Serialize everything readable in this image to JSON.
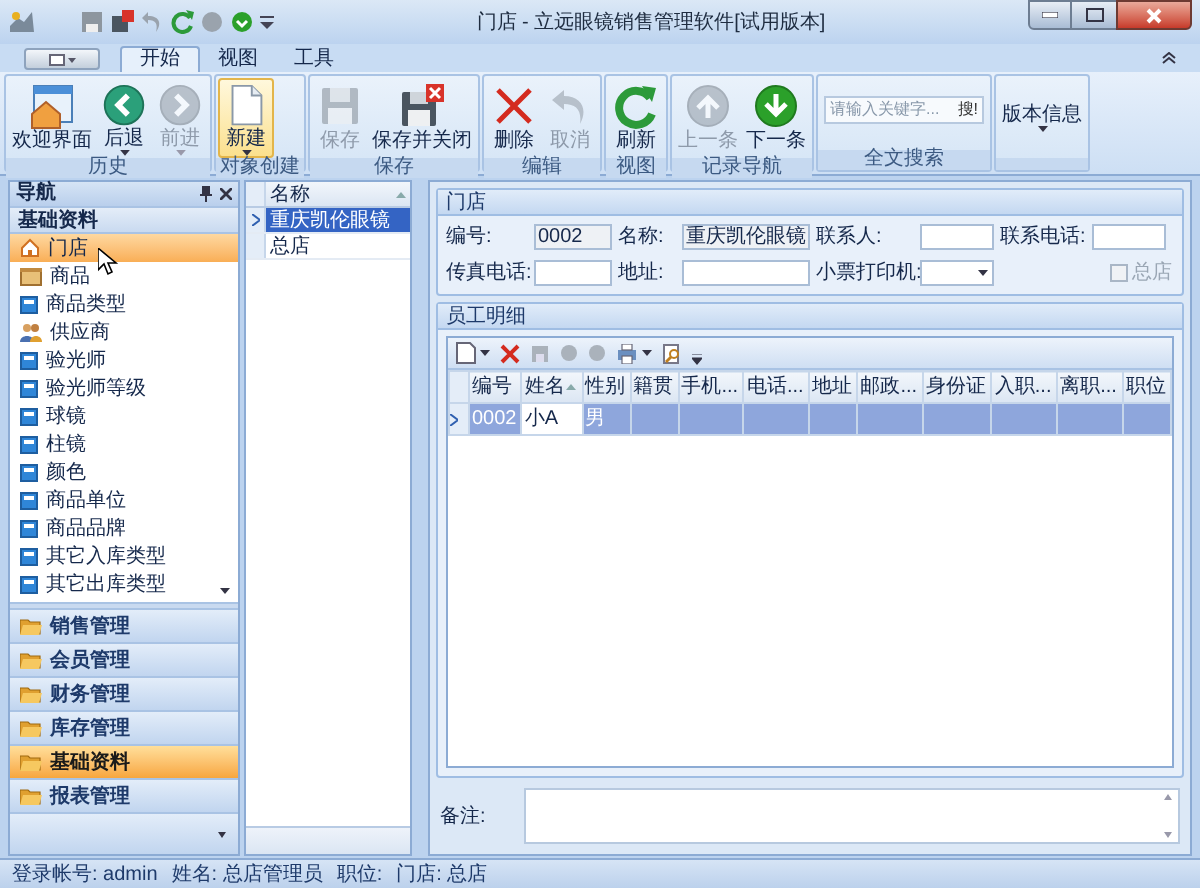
{
  "window": {
    "title": "门店 - 立远眼镜销售管理软件[试用版本]"
  },
  "tabs": [
    {
      "label": "开始",
      "selected": true
    },
    {
      "label": "视图",
      "selected": false
    },
    {
      "label": "工具",
      "selected": false
    }
  ],
  "ribbon": {
    "groups": [
      {
        "label": "历史",
        "buttons": [
          {
            "label": "欢迎界面",
            "kind": "home",
            "disabled": false,
            "highlighted": false,
            "dropdown": false
          },
          {
            "label": "后退",
            "kind": "back",
            "disabled": false,
            "highlighted": false,
            "dropdown": true
          },
          {
            "label": "前进",
            "kind": "forward",
            "disabled": true,
            "highlighted": false,
            "dropdown": true
          }
        ]
      },
      {
        "label": "对象创建",
        "buttons": [
          {
            "label": "新建",
            "kind": "new",
            "disabled": false,
            "highlighted": true,
            "dropdown": true
          }
        ]
      },
      {
        "label": "保存",
        "buttons": [
          {
            "label": "保存",
            "kind": "save",
            "disabled": true,
            "highlighted": false,
            "dropdown": false
          },
          {
            "label": "保存并关闭",
            "kind": "saveclose",
            "disabled": false,
            "highlighted": false,
            "dropdown": false
          }
        ]
      },
      {
        "label": "编辑",
        "buttons": [
          {
            "label": "删除",
            "kind": "delete",
            "disabled": false,
            "highlighted": false,
            "dropdown": false
          },
          {
            "label": "取消",
            "kind": "undo",
            "disabled": true,
            "highlighted": false,
            "dropdown": false
          }
        ]
      },
      {
        "label": "视图",
        "buttons": [
          {
            "label": "刷新",
            "kind": "refresh",
            "disabled": false,
            "highlighted": false,
            "dropdown": false
          }
        ]
      },
      {
        "label": "记录导航",
        "buttons": [
          {
            "label": "上一条",
            "kind": "up",
            "disabled": true,
            "highlighted": false,
            "dropdown": false
          },
          {
            "label": "下一条",
            "kind": "down",
            "disabled": false,
            "highlighted": false,
            "dropdown": false
          }
        ]
      },
      {
        "label": "全文搜索",
        "kind": "search",
        "placeholder": "请输入关键字...",
        "button": "搜!"
      },
      {
        "buttons": [
          {
            "label": "版本信息",
            "kind": "text",
            "disabled": false,
            "highlighted": false,
            "dropdown": true
          }
        ]
      }
    ]
  },
  "nav": {
    "title": "导航",
    "section": "基础资料",
    "items": [
      {
        "label": "门店",
        "kind": "home",
        "selected": true
      },
      {
        "label": "商品",
        "kind": "box",
        "selected": false
      },
      {
        "label": "商品类型",
        "kind": "doc",
        "selected": false
      },
      {
        "label": "供应商",
        "kind": "people",
        "selected": false
      },
      {
        "label": "验光师",
        "kind": "doc",
        "selected": false
      },
      {
        "label": "验光师等级",
        "kind": "doc",
        "selected": false
      },
      {
        "label": "球镜",
        "kind": "doc",
        "selected": false
      },
      {
        "label": "柱镜",
        "kind": "doc",
        "selected": false
      },
      {
        "label": "颜色",
        "kind": "doc",
        "selected": false
      },
      {
        "label": "商品单位",
        "kind": "doc",
        "selected": false
      },
      {
        "label": "商品品牌",
        "kind": "doc",
        "selected": false
      },
      {
        "label": "其它入库类型",
        "kind": "doc",
        "selected": false
      },
      {
        "label": "其它出库类型",
        "kind": "doc",
        "selected": false
      }
    ],
    "groups": [
      {
        "label": "销售管理",
        "selected": false
      },
      {
        "label": "会员管理",
        "selected": false
      },
      {
        "label": "财务管理",
        "selected": false
      },
      {
        "label": "库存管理",
        "selected": false
      },
      {
        "label": "基础资料",
        "selected": true
      },
      {
        "label": "报表管理",
        "selected": false
      }
    ]
  },
  "list": {
    "column": "名称",
    "sorted": true,
    "rows": [
      {
        "label": "重庆凯伦眼镜",
        "selected": true
      },
      {
        "label": "总店",
        "selected": false
      }
    ]
  },
  "store": {
    "title": "门店",
    "fields": [
      {
        "label": "编号:",
        "value": "0002",
        "kind": "readonly"
      },
      {
        "label": "名称:",
        "value": "重庆凯伦眼镜",
        "kind": "readonly"
      },
      {
        "label": "联系人:",
        "kind": "text"
      },
      {
        "label": "联系电话:",
        "kind": "text"
      },
      {
        "label": "传真电话:",
        "kind": "text"
      },
      {
        "label": "地址:",
        "kind": "text"
      },
      {
        "label": "小票打印机:",
        "kind": "select"
      },
      {
        "label": "总店",
        "kind": "checkbox",
        "checked": false,
        "disabled": true
      }
    ]
  },
  "employees": {
    "title": "员工明细",
    "columns": [
      {
        "label": "编号",
        "sorted": false
      },
      {
        "label": "姓名",
        "sorted": true
      },
      {
        "label": "性别",
        "sorted": false
      },
      {
        "label": "籍贯",
        "sorted": false
      },
      {
        "label": "手机...",
        "sorted": false
      },
      {
        "label": "电话...",
        "sorted": false
      },
      {
        "label": "地址",
        "sorted": false
      },
      {
        "label": "邮政...",
        "sorted": false
      },
      {
        "label": "身份证",
        "sorted": false
      },
      {
        "label": "入职...",
        "sorted": false
      },
      {
        "label": "离职...",
        "sorted": false
      },
      {
        "label": "职位",
        "sorted": false
      }
    ],
    "rows": [
      {
        "selected": true,
        "cells": [
          {
            "text": "0002",
            "focused": false
          },
          {
            "text": "小A",
            "focused": true
          },
          {
            "text": "男",
            "focused": false
          }
        ]
      }
    ]
  },
  "remark": {
    "label": "备注:"
  },
  "status_bar": [
    "登录帐号: admin",
    "姓名: 总店管理员",
    "职位:",
    "门店: 总店"
  ]
}
